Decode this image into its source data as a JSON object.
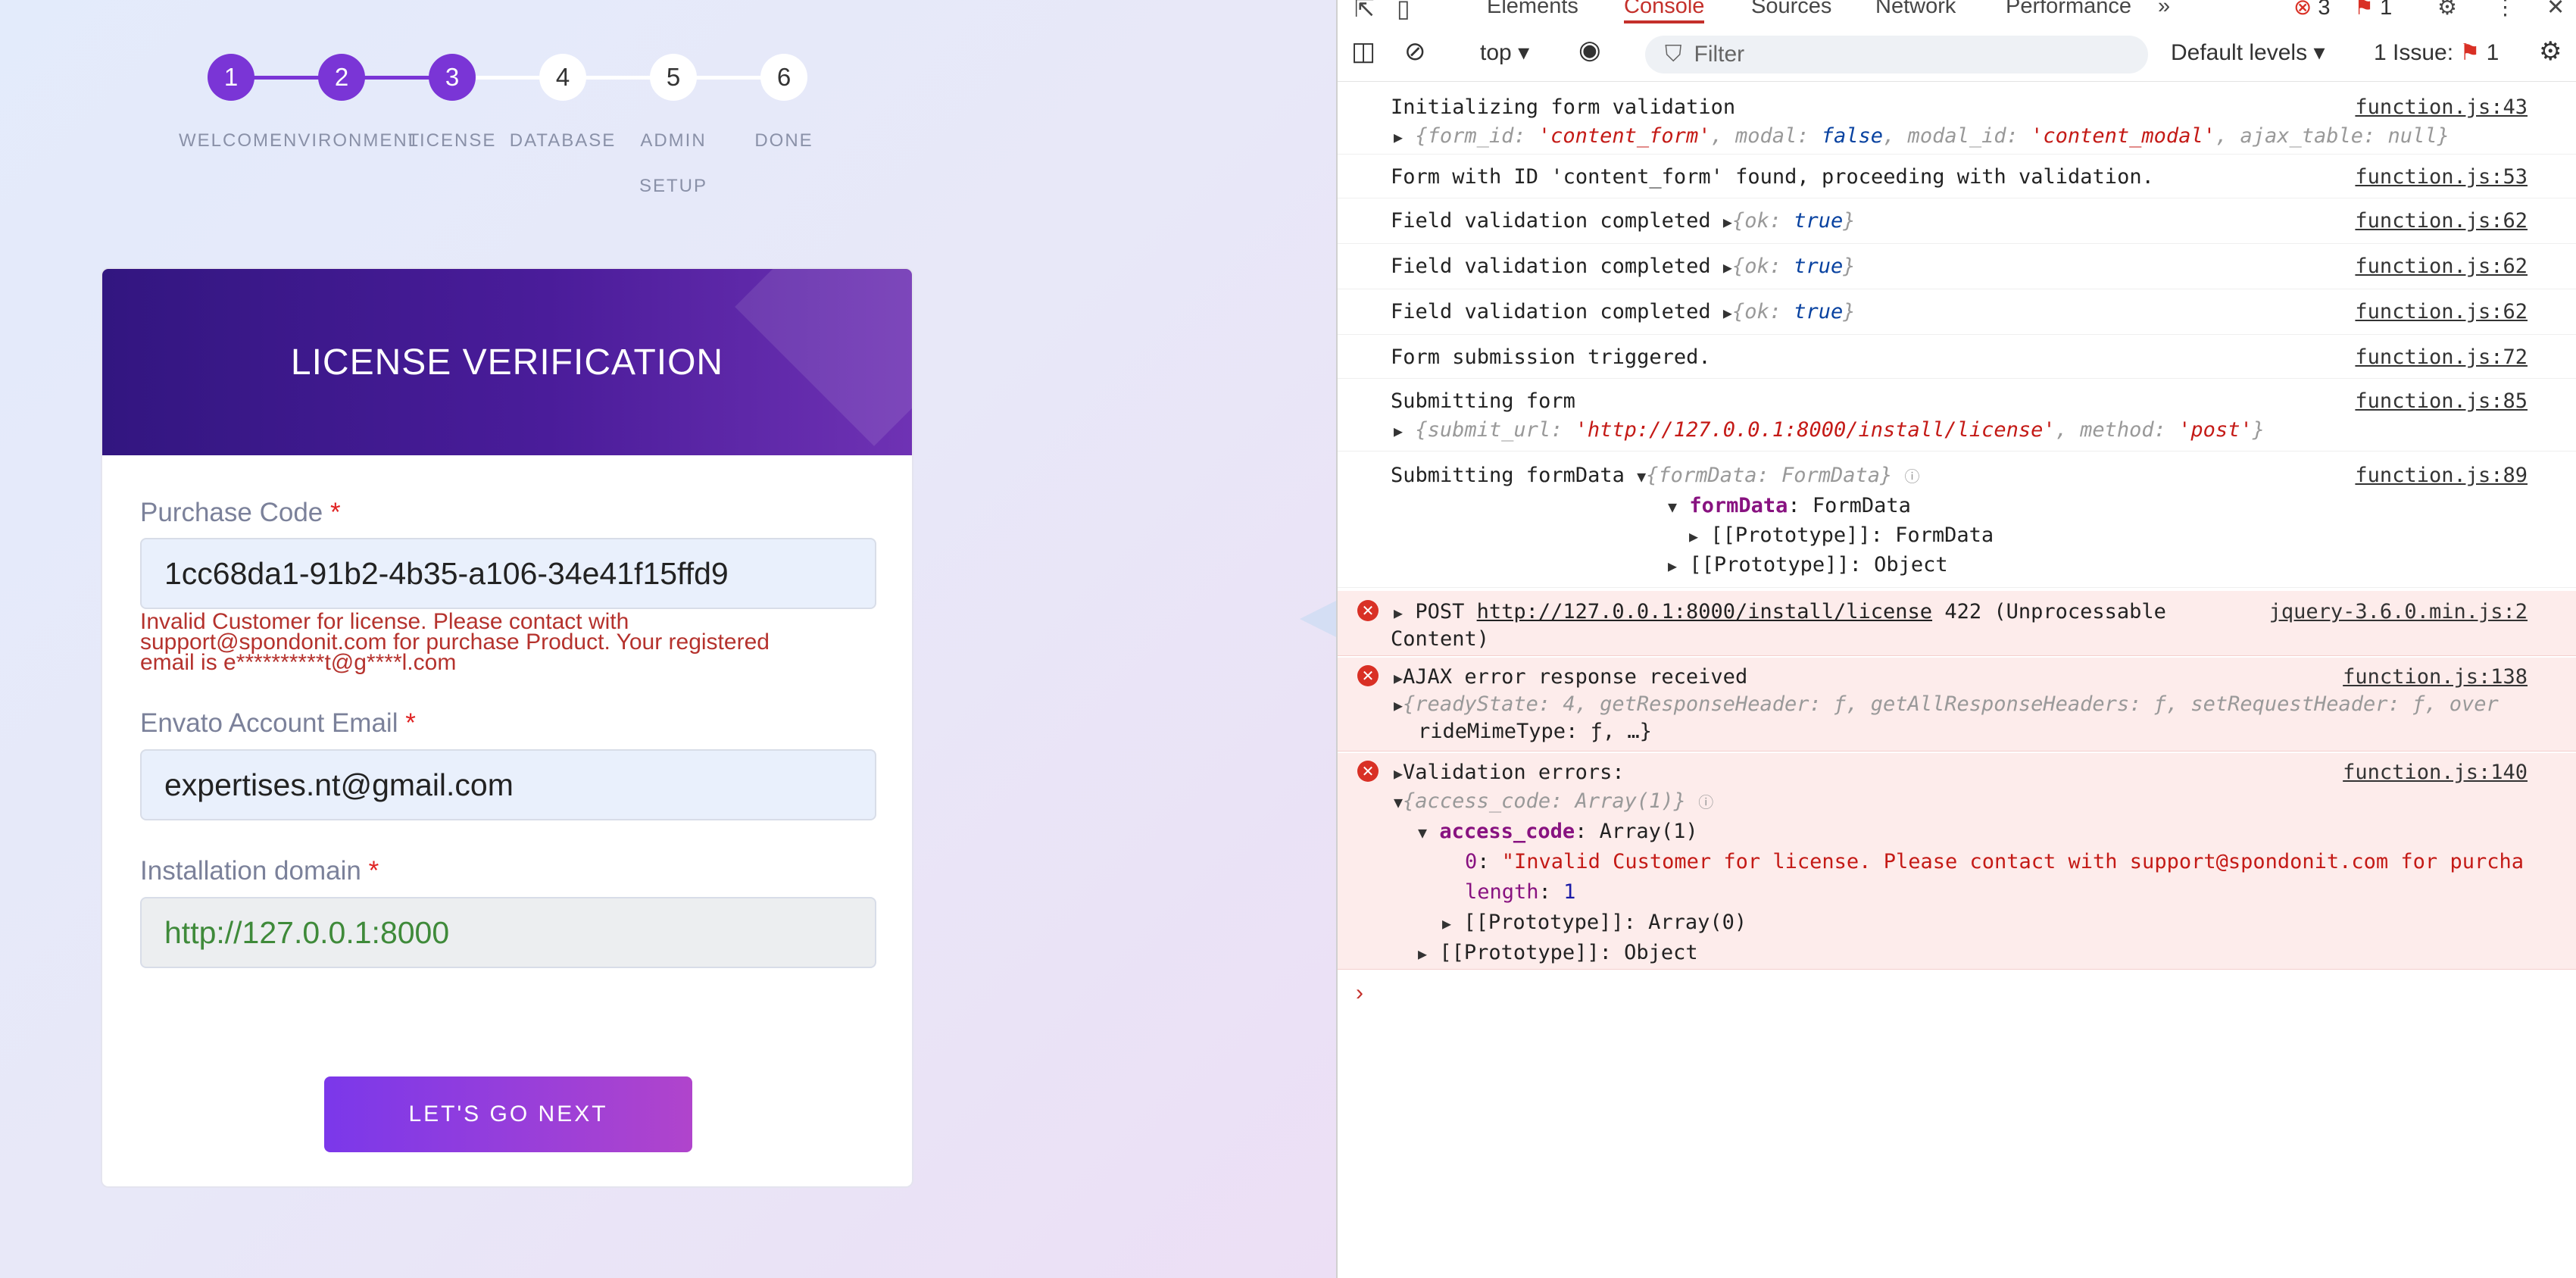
{
  "stepper": {
    "steps": [
      {
        "num": "1",
        "label": "WELCOME"
      },
      {
        "num": "2",
        "label": "ENVIRONMENT"
      },
      {
        "num": "3",
        "label": "LICENSE"
      },
      {
        "num": "4",
        "label": "DATABASE"
      },
      {
        "num": "5",
        "label": "ADMIN SETUP"
      },
      {
        "num": "6",
        "label": "DONE"
      }
    ]
  },
  "card": {
    "title": "LICENSE VERIFICATION",
    "purchase_code": {
      "label": "Purchase Code",
      "required": "*",
      "value": "1cc68da1-91b2-4b35-a106-34e41f15ffd9",
      "error_lines": [
        "Invalid Customer for license. Please contact with",
        "support@spondonit.com for purchase Product. Your registered",
        "email is e**********t@g****l.com"
      ]
    },
    "email": {
      "label": "Envato Account Email",
      "required": "*",
      "value": "expertises.nt@gmail.com"
    },
    "domain": {
      "label": "Installation domain",
      "required": "*",
      "value": "http://127.0.0.1:8000"
    },
    "next_button": "LET'S GO NEXT"
  },
  "devtools": {
    "tabs": [
      "Elements",
      "Console",
      "Sources",
      "Network",
      "Performance"
    ],
    "active_tab": "Console",
    "more_tabs": "»",
    "error_count": "3",
    "issue_badge_count": "1",
    "context": "top",
    "filter_placeholder": "Filter",
    "levels": "Default levels",
    "issues": "1 Issue:",
    "issues_count": "1",
    "logs": {
      "l1": {
        "text": "Initializing form validation",
        "src": "function.js:43",
        "obj": [
          "{form_id: ",
          "'content_form'",
          ", modal: ",
          "false",
          ", modal_id: ",
          "'content_modal'",
          ", ajax_table: ",
          "null",
          "}"
        ]
      },
      "l2": {
        "text": "Form with ID 'content_form' found, proceeding with validation.",
        "src": "function.js:53"
      },
      "l3": {
        "text": "Field validation completed",
        "obj": [
          "{ok: ",
          "true",
          "}"
        ],
        "src": "function.js:62"
      },
      "l4": {
        "text": "Field validation completed",
        "obj": [
          "{ok: ",
          "true",
          "}"
        ],
        "src": "function.js:62"
      },
      "l5": {
        "text": "Field validation completed",
        "obj": [
          "{ok: ",
          "true",
          "}"
        ],
        "src": "function.js:62"
      },
      "l6": {
        "text": "Form submission triggered.",
        "src": "function.js:72"
      },
      "l7": {
        "text": "Submitting form",
        "src": "function.js:85",
        "obj": [
          "{submit_url: ",
          "'http://127.0.0.1:8000/install/license'",
          ", method: ",
          "'post'",
          "}"
        ]
      },
      "l8": {
        "text": "Submitting formData",
        "obj": "{formData: FormData}",
        "src": "function.js:89",
        "child1_key": "formData",
        "child1_val": ": FormData",
        "child2": "[[Prototype]]: FormData",
        "child3": "[[Prototype]]: Object"
      },
      "e1": {
        "method": "POST",
        "url": "http://127.0.0.1:8000/install/license",
        "status": "422 (Unprocessable",
        "status2": "Content)",
        "src": "jquery-3.6.0.min.js:2"
      },
      "e2": {
        "text": "AJAX error response received",
        "src": "function.js:138",
        "line1": "{readyState: 4, getResponseHeader: ƒ, getAllResponseHeaders: ƒ, setRequestHeader: ƒ, over",
        "line2": "rideMimeType: ƒ, …}"
      },
      "e3": {
        "text": "Validation errors:",
        "src": "function.js:140",
        "obj": "{access_code: Array(1)}",
        "key": "access_code",
        "val": ": Array(1)",
        "idx": "0",
        "msg": "\"Invalid Customer for license. Please contact with support@spondonit.com for purcha",
        "len_key": "length",
        "len_val": "1",
        "proto1": "[[Prototype]]: Array(0)",
        "proto2": "[[Prototype]]: Object"
      }
    }
  }
}
